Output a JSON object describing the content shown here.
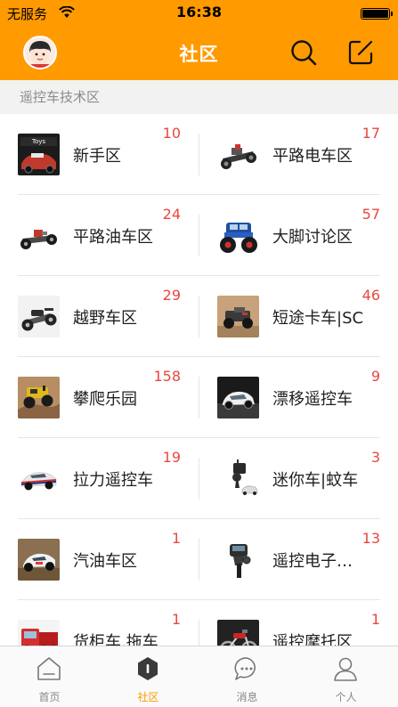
{
  "status": {
    "carrier": "无服务",
    "time": "16:38"
  },
  "nav": {
    "title": "社区"
  },
  "section": {
    "title": "遥控车技术区"
  },
  "forums": [
    {
      "name": "新手区",
      "count": "10",
      "thumb": "magazine"
    },
    {
      "name": "平路电车区",
      "count": "17",
      "thumb": "chassis-dark"
    },
    {
      "name": "平路油车区",
      "count": "24",
      "thumb": "chassis-red"
    },
    {
      "name": "大脚讨论区",
      "count": "57",
      "thumb": "monster-truck"
    },
    {
      "name": "越野车区",
      "count": "29",
      "thumb": "buggy"
    },
    {
      "name": "短途卡车|SC",
      "count": "46",
      "thumb": "sc-truck"
    },
    {
      "name": "攀爬乐园",
      "count": "158",
      "thumb": "crawler"
    },
    {
      "name": "漂移遥控车",
      "count": "9",
      "thumb": "drift-car"
    },
    {
      "name": "拉力遥控车",
      "count": "19",
      "thumb": "rally-car"
    },
    {
      "name": "迷你车|蚊车",
      "count": "3",
      "thumb": "mini-car"
    },
    {
      "name": "汽油车区",
      "count": "1",
      "thumb": "gas-car"
    },
    {
      "name": "遥控电子…",
      "count": "13",
      "thumb": "transmitter"
    },
    {
      "name": "货柜车.拖车",
      "count": "1",
      "thumb": "container-truck"
    },
    {
      "name": "遥控摩托区",
      "count": "1",
      "thumb": "motorbike"
    }
  ],
  "tabs": [
    {
      "label": "首页",
      "icon": "home-icon",
      "active": false
    },
    {
      "label": "社区",
      "icon": "community-icon",
      "active": true
    },
    {
      "label": "消息",
      "icon": "message-icon",
      "active": false
    },
    {
      "label": "个人",
      "icon": "person-icon",
      "active": false
    }
  ],
  "colors": {
    "accent": "#ff9a00",
    "count": "#e8473e",
    "separator": "#e6e6e6"
  }
}
